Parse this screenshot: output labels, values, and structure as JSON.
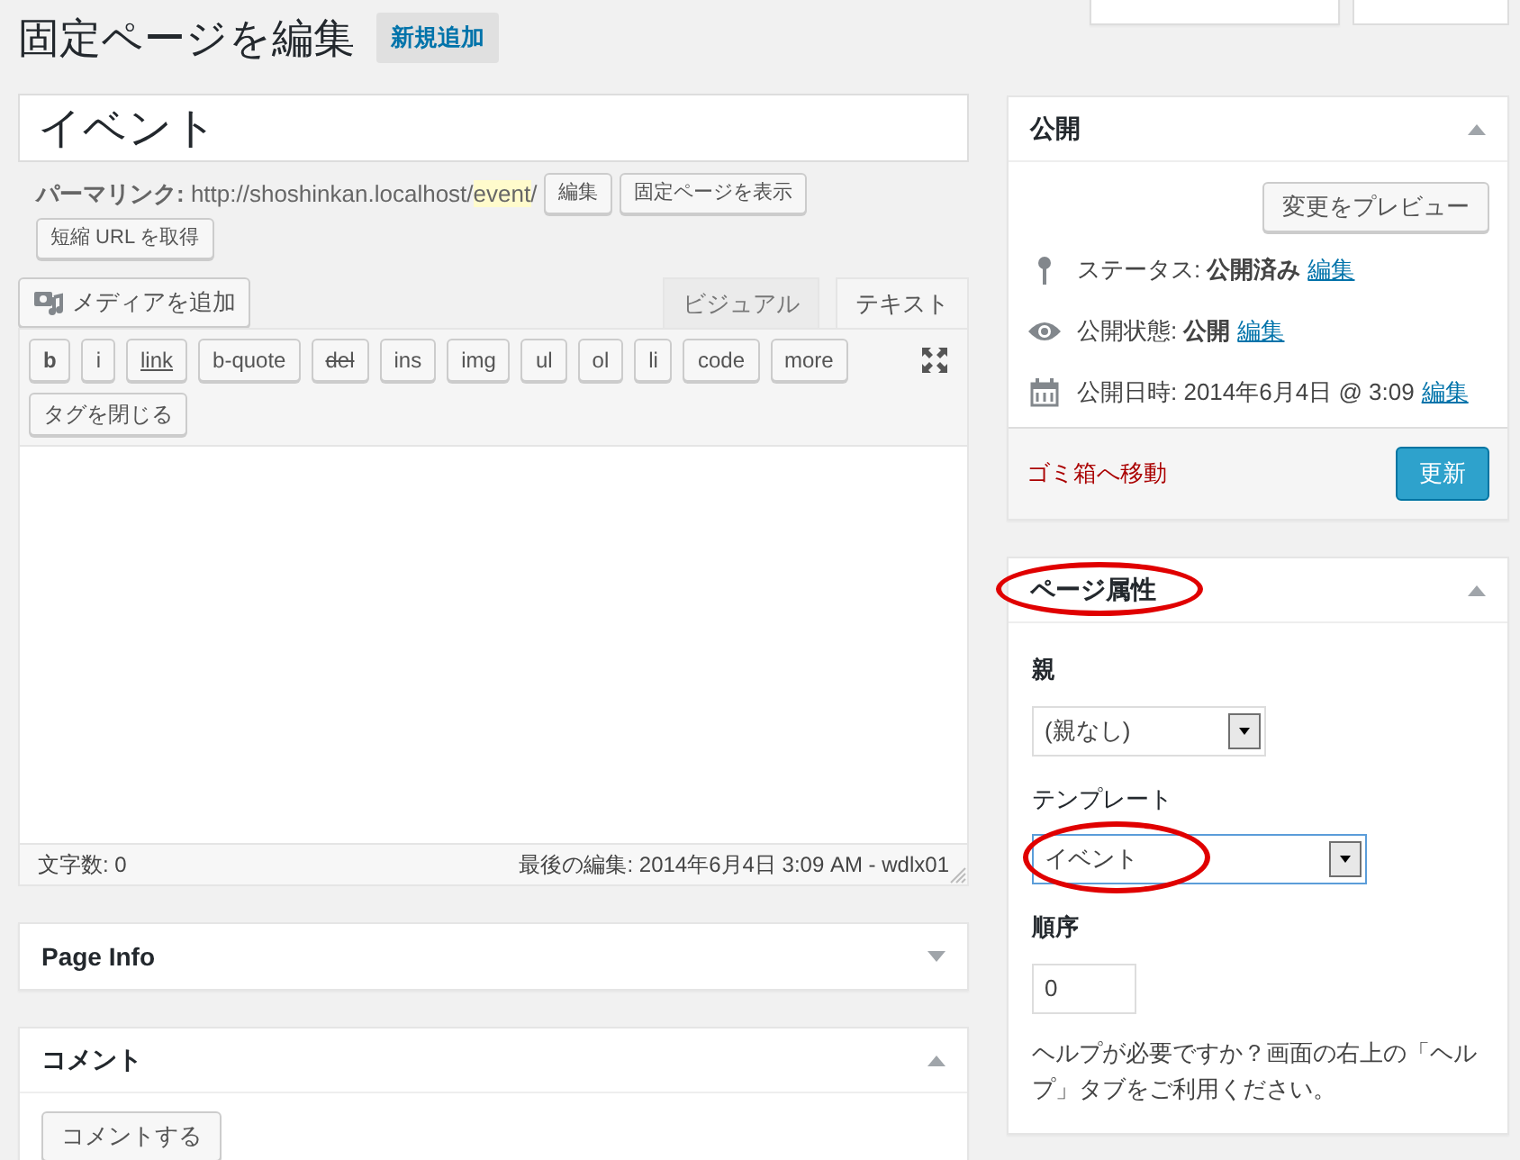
{
  "header": {
    "title": "固定ページを編集",
    "add_new": "新規追加"
  },
  "post_title": {
    "value": "イベント"
  },
  "permalink": {
    "label": "パーマリンク:",
    "url_base": "http://shoshinkan.localhost/",
    "slug": "event",
    "url_end": "/",
    "buttons": [
      "編集",
      "固定ページを表示",
      "短縮 URL を取得"
    ]
  },
  "media_button": "メディアを追加",
  "editor_tabs": [
    {
      "label": "ビジュアル",
      "selected": false
    },
    {
      "label": "テキスト",
      "selected": true
    }
  ],
  "quicktags": [
    {
      "label": "b",
      "kind": "bold"
    },
    {
      "label": "i",
      "kind": "plain"
    },
    {
      "label": "link",
      "kind": "underline"
    },
    {
      "label": "b-quote",
      "kind": "plain"
    },
    {
      "label": "del",
      "kind": "strike"
    },
    {
      "label": "ins",
      "kind": "plain"
    },
    {
      "label": "img",
      "kind": "plain"
    },
    {
      "label": "ul",
      "kind": "plain"
    },
    {
      "label": "ol",
      "kind": "plain"
    },
    {
      "label": "li",
      "kind": "plain"
    },
    {
      "label": "code",
      "kind": "plain"
    },
    {
      "label": "more",
      "kind": "plain"
    },
    {
      "label": "タグを閉じる",
      "kind": "plain"
    }
  ],
  "status_bar": {
    "word_count": "文字数: 0",
    "last_edit": "最後の編集: 2014年6月4日 3:09 AM - wdlx01"
  },
  "main_boxes": [
    {
      "title": "Page Info",
      "expanded": false
    },
    {
      "title": "コメント",
      "expanded": true,
      "button": "コメントする"
    }
  ],
  "publish": {
    "title": "公開",
    "expanded": true,
    "preview": "変更をプレビュー",
    "rows": [
      {
        "kind": "pin",
        "text": "ステータス: **公開済み**",
        "link": "編集"
      },
      {
        "kind": "eye",
        "text": "公開状態: **公開**",
        "link": "編集"
      },
      {
        "kind": "calendar",
        "text": "公開日時: 2014年6月4日 @ 3:09",
        "link": "編集"
      }
    ],
    "trash": "ゴミ箱へ移動",
    "update": "更新"
  },
  "page_attributes": {
    "title": "ページ属性",
    "title_highlighted": true,
    "expanded": true,
    "parent_label": "親",
    "parent_value": "(親なし)",
    "template_label": "テンプレート",
    "template_value": "イベント",
    "template_highlighted": true,
    "order_label": "順序",
    "order_value": "0",
    "help": "ヘルプが必要ですか？画面の右上の「ヘルプ」タブをご利用ください。"
  }
}
